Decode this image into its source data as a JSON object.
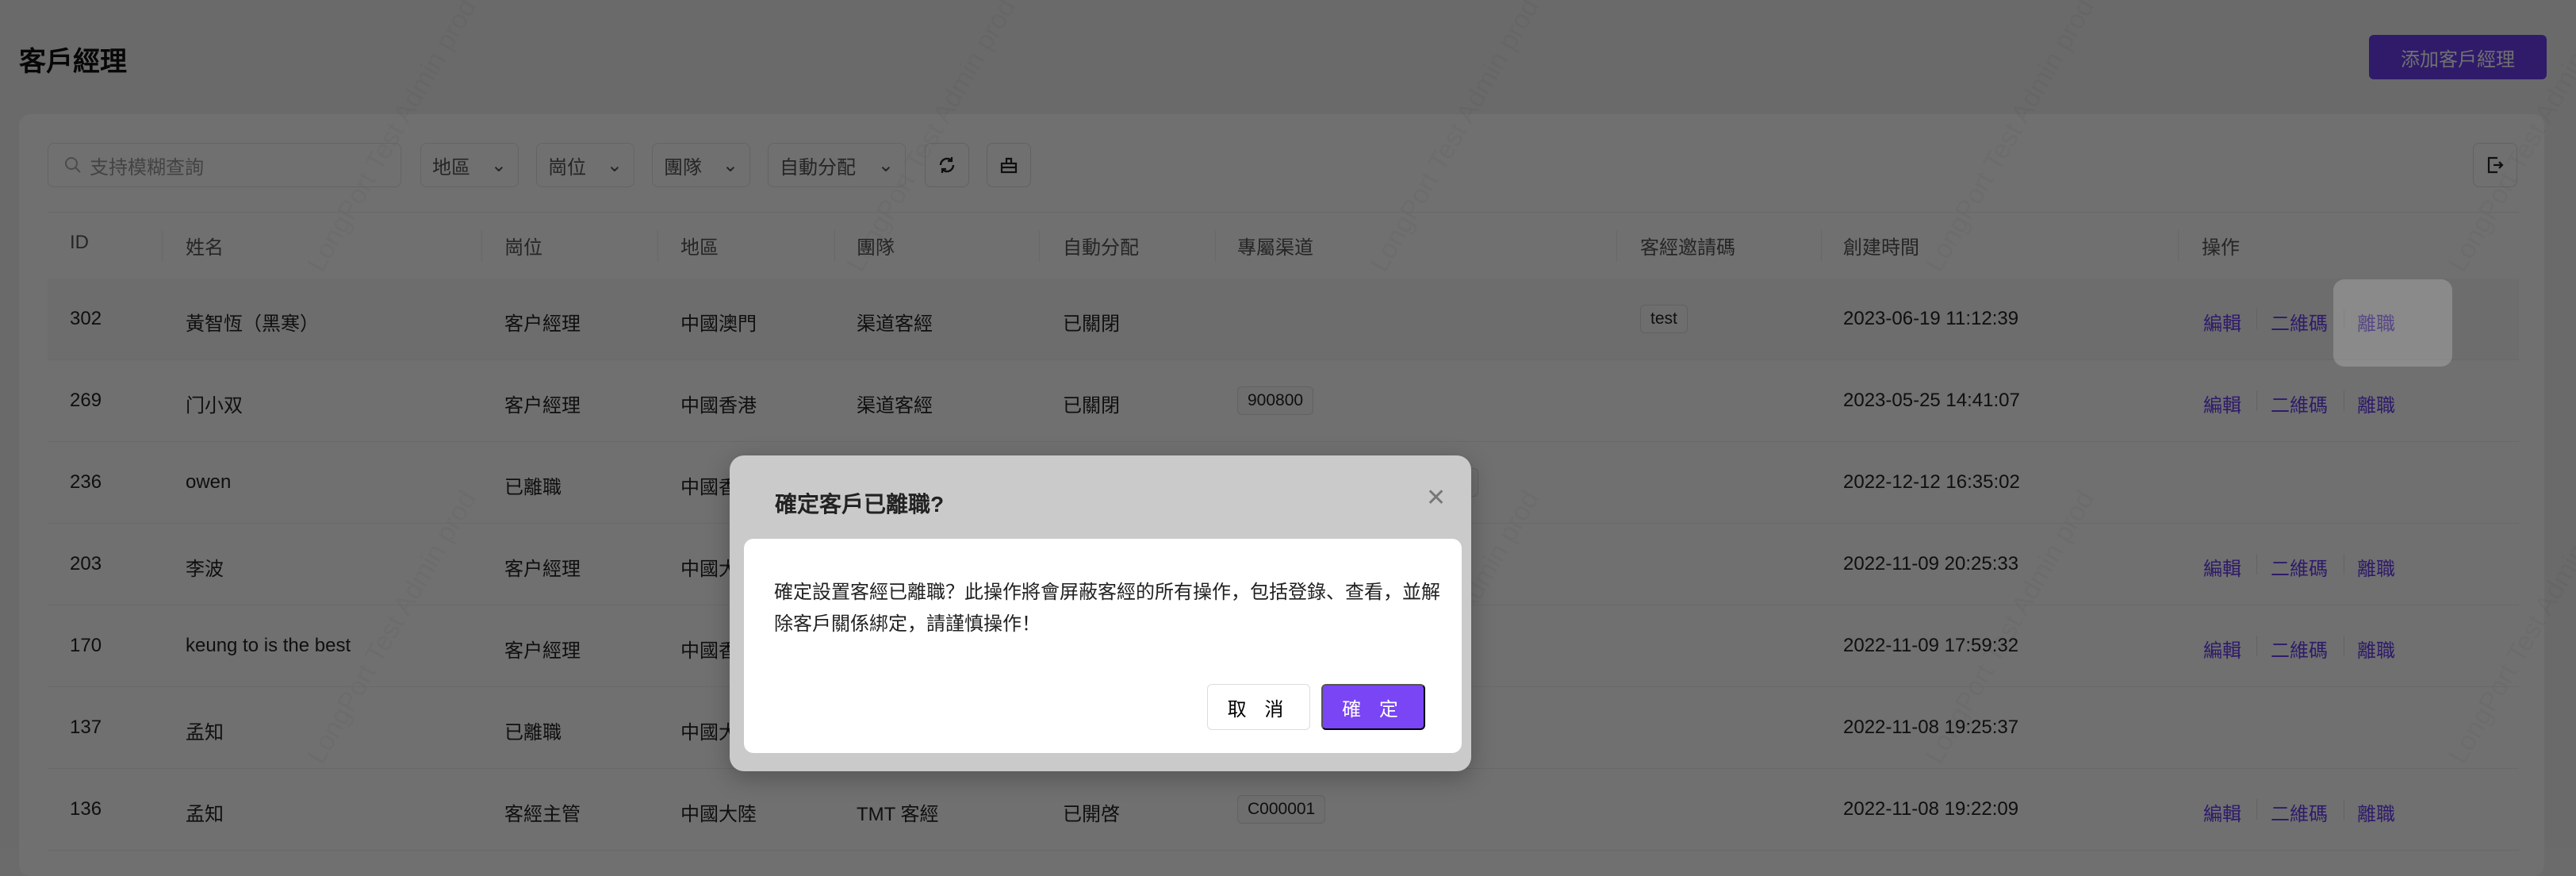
{
  "page": {
    "title": "客戶經理",
    "add_button": "添加客戶經理",
    "watermark": "LongPort Test Admin prod"
  },
  "toolbar": {
    "search_placeholder": "支持模糊查詢",
    "filters": [
      "地區",
      "崗位",
      "團隊",
      "自動分配"
    ],
    "icons": [
      "refresh-icon",
      "clear-icon",
      "export-icon"
    ]
  },
  "table": {
    "columns": [
      "ID",
      "姓名",
      "崗位",
      "地區",
      "團隊",
      "自動分配",
      "專屬渠道",
      "客經邀請碼",
      "創建時間",
      "操作"
    ],
    "rows": [
      {
        "id": "302",
        "name": "黃智恆（黑寒）",
        "role": "客户經理",
        "region": "中國澳門",
        "team": "渠道客經",
        "auto": "已關閉",
        "channel": "",
        "invite": "test",
        "created": "2023-06-19 11:12:39",
        "actions": true
      },
      {
        "id": "269",
        "name": "门小双",
        "role": "客户經理",
        "region": "中國香港",
        "team": "渠道客經",
        "auto": "已關閉",
        "channel": "900800",
        "invite": "",
        "created": "2023-05-25 14:41:07",
        "actions": true
      },
      {
        "id": "236",
        "name": "owen",
        "role": "已離職",
        "region": "中國香港",
        "team": "",
        "auto": "",
        "channel": "",
        "invite": "",
        "created": "2022-12-12 16:35:02",
        "actions": false
      },
      {
        "id": "203",
        "name": "李波",
        "role": "客户經理",
        "region": "中國大陸",
        "team": "",
        "auto": "",
        "channel": "",
        "invite": "",
        "created": "2022-11-09 20:25:33",
        "actions": true
      },
      {
        "id": "170",
        "name": "keung to is the best",
        "role": "客户經理",
        "region": "中國香港",
        "team": "",
        "auto": "",
        "channel": "",
        "invite": "",
        "created": "2022-11-09 17:59:32",
        "actions": true
      },
      {
        "id": "137",
        "name": "孟知",
        "role": "已離職",
        "region": "中國大陸",
        "team": "",
        "auto": "",
        "channel": "",
        "invite": "",
        "created": "2022-11-08 19:25:37",
        "actions": false
      },
      {
        "id": "136",
        "name": "孟知",
        "role": "客經主管",
        "region": "中國大陸",
        "team": "TMT 客經",
        "auto": "已開啓",
        "channel": "C000001",
        "invite": "",
        "created": "2022-11-08 19:22:09",
        "actions": true
      }
    ],
    "action_labels": {
      "edit": "編輯",
      "qrcode": "二維碼",
      "resign": "離職"
    }
  },
  "dialog": {
    "title": "確定客戶已離職?",
    "body": "確定設置客經已離職？此操作將會屏蔽客經的所有操作，包括登錄、查看，並解除客戶關係綁定，請謹慎操作！",
    "cancel": "取 消",
    "confirm": "確 定"
  },
  "colors": {
    "accent": "#6a3ef0",
    "confirm": "#7a45f5"
  }
}
